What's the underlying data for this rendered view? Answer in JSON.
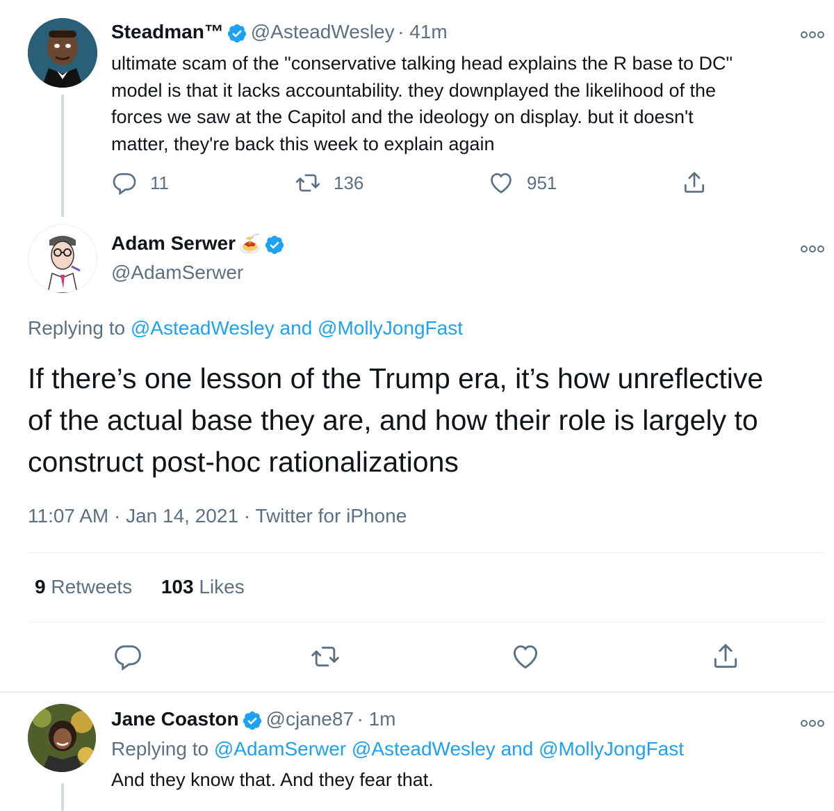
{
  "tweet1": {
    "name": "Steadman™",
    "handle": "@AsteadWesley",
    "time": "· 41m",
    "lines": [
      "ultimate scam of the \"conservative talking head explains the R base to DC\"",
      "model is that it lacks accountability. they downplayed the likelihood of the",
      "forces we saw at the Capitol and the ideology on display. but it doesn't",
      "matter, they're back this week to explain again"
    ],
    "replies": "11",
    "retweets": "136",
    "likes": "951"
  },
  "main": {
    "name": "Adam Serwer",
    "name_emoji": "🍝",
    "handle": "@AdamSerwer",
    "replying_prefix": "Replying to",
    "replying_user1": "@AsteadWesley",
    "replying_and": "and",
    "replying_user2": "@MollyJongFast",
    "lines": [
      "If there’s one lesson of the Trump era, it’s how unreflective",
      "of the actual base they are, and how their role is largely to",
      "construct post-hoc rationalizations"
    ],
    "meta": "11:07 AM · Jan 14, 2021 · Twitter for iPhone",
    "retweet_count": "9",
    "retweet_label": "Retweets",
    "like_count": "103",
    "like_label": "Likes"
  },
  "tweet3": {
    "name": "Jane Coaston",
    "handle": "@cjane87",
    "time": "· 1m",
    "replying_prefix": "Replying to",
    "replying_user1": "@AdamSerwer",
    "replying_user2": "@AsteadWesley",
    "replying_and": "and",
    "replying_user3": "@MollyJongFast",
    "text": "And they know that. And they fear that."
  },
  "icons": {
    "verified": "verified-badge-icon",
    "reply": "reply-icon",
    "retweet": "retweet-icon",
    "like": "heart-icon",
    "share": "share-icon",
    "more": "more-options-icon"
  },
  "colors": {
    "accent": "#1da1f2",
    "secondary_text": "#5b7083",
    "divider": "#e6ecf0"
  }
}
